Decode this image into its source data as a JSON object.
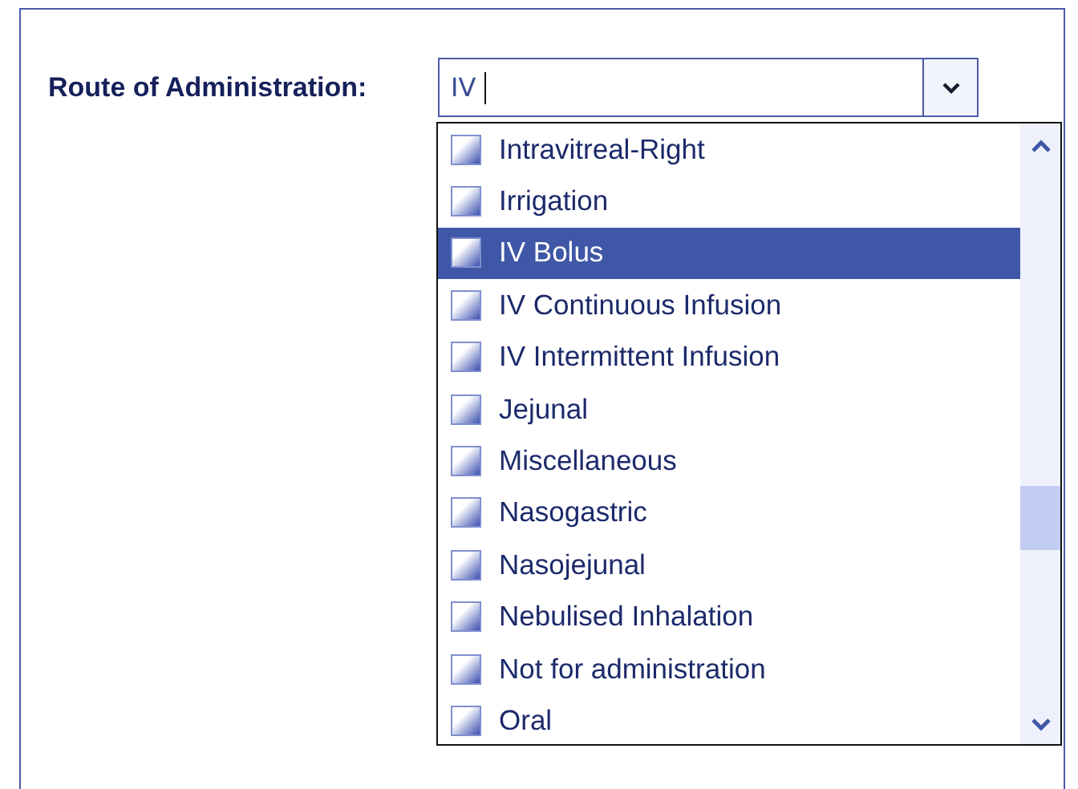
{
  "field": {
    "label": "Route of Administration:",
    "value": "IV"
  },
  "options": [
    {
      "label": "Intravitreal-Right",
      "selected": false
    },
    {
      "label": "Irrigation",
      "selected": false
    },
    {
      "label": "IV Bolus",
      "selected": true
    },
    {
      "label": "IV Continuous Infusion",
      "selected": false
    },
    {
      "label": "IV Intermittent Infusion",
      "selected": false
    },
    {
      "label": "Jejunal",
      "selected": false
    },
    {
      "label": "Miscellaneous",
      "selected": false
    },
    {
      "label": "Nasogastric",
      "selected": false
    },
    {
      "label": "Nasojejunal",
      "selected": false
    },
    {
      "label": "Nebulised Inhalation",
      "selected": false
    },
    {
      "label": "Not for administration",
      "selected": false
    },
    {
      "label": "Oral",
      "selected": false
    }
  ]
}
